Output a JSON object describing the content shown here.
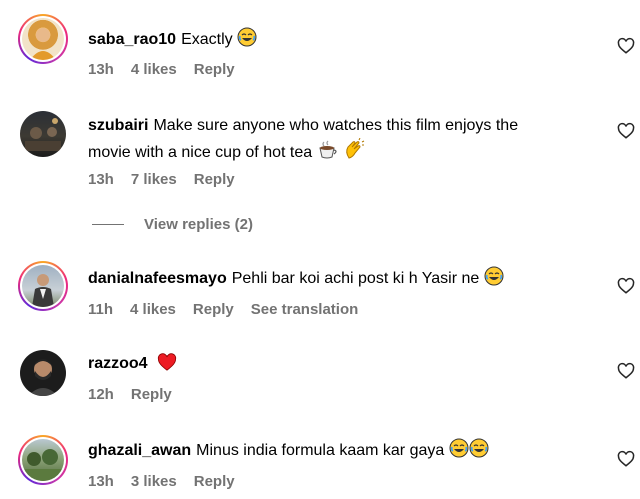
{
  "comments": [
    {
      "username": "saba_rao10",
      "text": "Exactly",
      "emoji": "face-with-tears-of-joy",
      "time": "13h",
      "likes": "4 likes",
      "reply": "Reply"
    },
    {
      "username": "szubairi",
      "text_line1": "Make sure anyone who watches this film enjoys the",
      "text_line2": "movie with a nice cup of hot tea",
      "emoji": [
        "hot-beverage",
        "clapping-hands"
      ],
      "time": "13h",
      "likes": "7 likes",
      "reply": "Reply",
      "view_replies": "View replies (2)"
    },
    {
      "username": "danialnafeesmayo",
      "text": "Pehli bar koi achi post ki h Yasir ne",
      "emoji": "face-with-tears-of-joy",
      "time": "11h",
      "likes": "4 likes",
      "reply": "Reply",
      "see_translation": "See translation"
    },
    {
      "username": "razzoo4",
      "text": "",
      "emoji": "red-heart",
      "time": "12h",
      "reply": "Reply"
    },
    {
      "username": "ghazali_awan",
      "text": "Minus india formula kaam kar gaya",
      "emoji": [
        "face-with-tears-of-joy",
        "face-with-tears-of-joy"
      ],
      "time": "13h",
      "likes": "3 likes",
      "reply": "Reply"
    }
  ],
  "icons": {
    "like": "heart-outline-icon",
    "more": "heart-outline-icon"
  },
  "colors": {
    "meta_gray": "#737373",
    "heart_red": "#ed1c24",
    "story_ring": "#ee2a7b"
  }
}
